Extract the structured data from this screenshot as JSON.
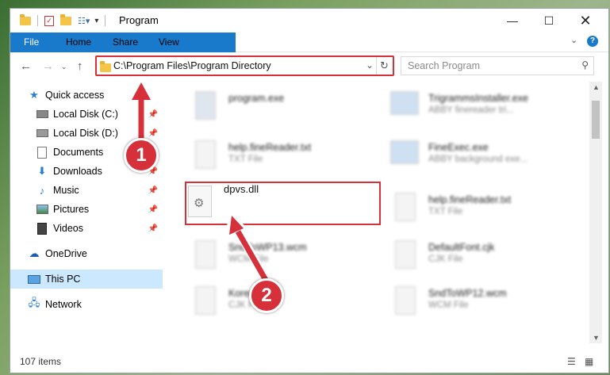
{
  "window": {
    "title": "Program"
  },
  "ribbon": {
    "tabs": [
      "File",
      "Home",
      "Share",
      "View"
    ]
  },
  "address": {
    "path": "C:\\Program Files\\Program Directory"
  },
  "search": {
    "placeholder": "Search Program"
  },
  "sidebar": {
    "items": [
      {
        "label": "Quick access",
        "icon": "star-icon",
        "pinned": false
      },
      {
        "label": "Local Disk (C:)",
        "icon": "drive-icon",
        "pinned": true
      },
      {
        "label": "Local Disk (D:)",
        "icon": "drive-icon",
        "pinned": true
      },
      {
        "label": "Documents",
        "icon": "document-icon",
        "pinned": true
      },
      {
        "label": "Downloads",
        "icon": "download-icon",
        "pinned": true
      },
      {
        "label": "Music",
        "icon": "music-icon",
        "pinned": true
      },
      {
        "label": "Pictures",
        "icon": "pictures-icon",
        "pinned": true
      },
      {
        "label": "Videos",
        "icon": "video-icon",
        "pinned": true
      },
      {
        "label": "OneDrive",
        "icon": "cloud-icon",
        "pinned": false
      },
      {
        "label": "This PC",
        "icon": "computer-icon",
        "pinned": false,
        "selected": true
      },
      {
        "label": "Network",
        "icon": "network-icon",
        "pinned": false
      }
    ]
  },
  "files": [
    {
      "name": "program.exe",
      "desc": ""
    },
    {
      "name": "TrigrammsInstaller.exe",
      "desc": "ABBY finereader tri..."
    },
    {
      "name": "help.fineReader.txt",
      "desc": "TXT File"
    },
    {
      "name": "FineExec.exe",
      "desc": "ABBY background exe..."
    },
    {
      "name": "dpvs.dll",
      "desc": ""
    },
    {
      "name": "help.fineReader.txt",
      "desc": "TXT File"
    },
    {
      "name": "SndToWP13.wcm",
      "desc": "WCM File"
    },
    {
      "name": "DefaultFont.cjk",
      "desc": "CJK File"
    },
    {
      "name": "Korean.cjk",
      "desc": "CJK File"
    },
    {
      "name": "SndToWP12.wcm",
      "desc": "WCM File"
    }
  ],
  "status": {
    "count": "107 items"
  },
  "annotations": {
    "step1": "1",
    "step2": "2"
  },
  "colors": {
    "accent": "#1979ca",
    "highlight": "#d6303a",
    "selection": "#cce8ff"
  }
}
